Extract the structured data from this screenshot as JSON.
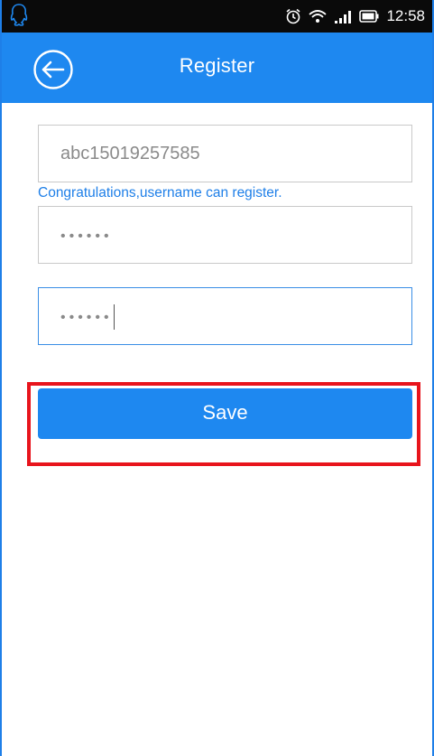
{
  "status_bar": {
    "time": "12:58",
    "icons": [
      "qq-icon",
      "alarm-icon",
      "wifi-icon",
      "signal-icon",
      "battery-icon"
    ]
  },
  "app_bar": {
    "title": "Register",
    "back_icon": "back-arrow-icon"
  },
  "form": {
    "username_value": "abc15019257585",
    "username_hint": "Congratulations,username can register.",
    "password_dots": "••••••",
    "confirm_password_dots": "••••••"
  },
  "actions": {
    "save_label": "Save"
  },
  "colors": {
    "accent": "#1e88f0",
    "hint_text": "#1e7fe8",
    "highlight": "#e8141c",
    "status_bar": "#0a0a0a"
  }
}
